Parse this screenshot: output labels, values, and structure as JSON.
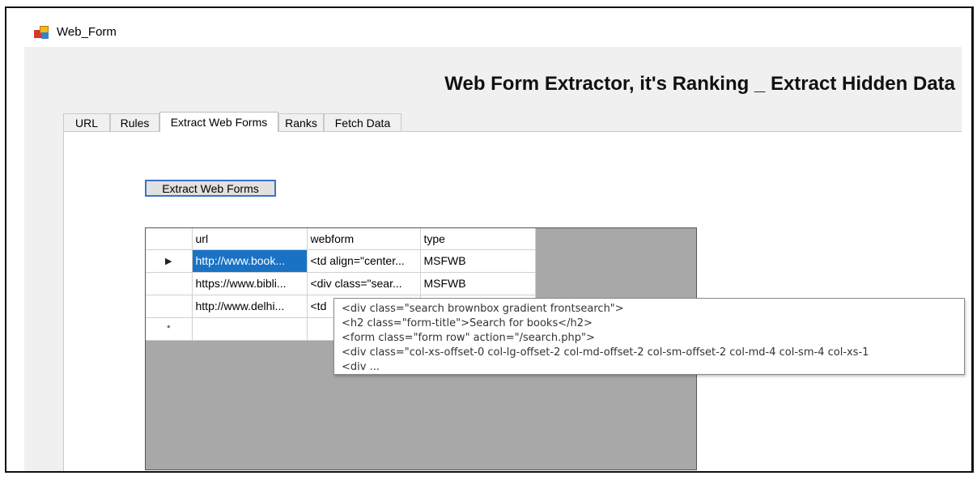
{
  "window": {
    "title": "Web_Form"
  },
  "heading": "Web Form Extractor, it's Ranking _ Extract Hidden Data",
  "tabs": [
    {
      "label": "URL",
      "active": false
    },
    {
      "label": "Rules",
      "active": false
    },
    {
      "label": "Extract Web Forms",
      "active": true
    },
    {
      "label": "Ranks",
      "active": false
    },
    {
      "label": "Fetch Data",
      "active": false
    }
  ],
  "extract_button": {
    "label": "Extract Web Forms"
  },
  "grid": {
    "columns": [
      "url",
      "webform",
      "type"
    ],
    "rows": [
      {
        "marker": "▶",
        "url": "http://www.book...",
        "webform": "<td align=\"center...",
        "type": "MSFWB",
        "selected": true
      },
      {
        "marker": "",
        "url": "https://www.bibli...",
        "webform": "<div class=\"sear...",
        "type": "MSFWB",
        "selected": false
      },
      {
        "marker": "",
        "url": "http://www.delhi...",
        "webform": "<td",
        "type": "",
        "selected": false
      },
      {
        "marker": "*",
        "url": "",
        "webform": "",
        "type": "",
        "selected": false
      }
    ]
  },
  "tooltip": {
    "lines": [
      "<div class=\"search brownbox gradient frontsearch\">",
      "<h2 class=\"form-title\">Search for books</h2>",
      "<form class=\"form row\" action=\"/search.php\">",
      "<div class=\"col-xs-offset-0 col-lg-offset-2 col-md-offset-2 col-sm-offset-2 col-md-4 col-sm-4 col-xs-1",
      "<div ..."
    ]
  },
  "colors": {
    "selection": "#1a72c4",
    "grid_background": "#a8a8a8",
    "button_border": "#3a73c7"
  }
}
